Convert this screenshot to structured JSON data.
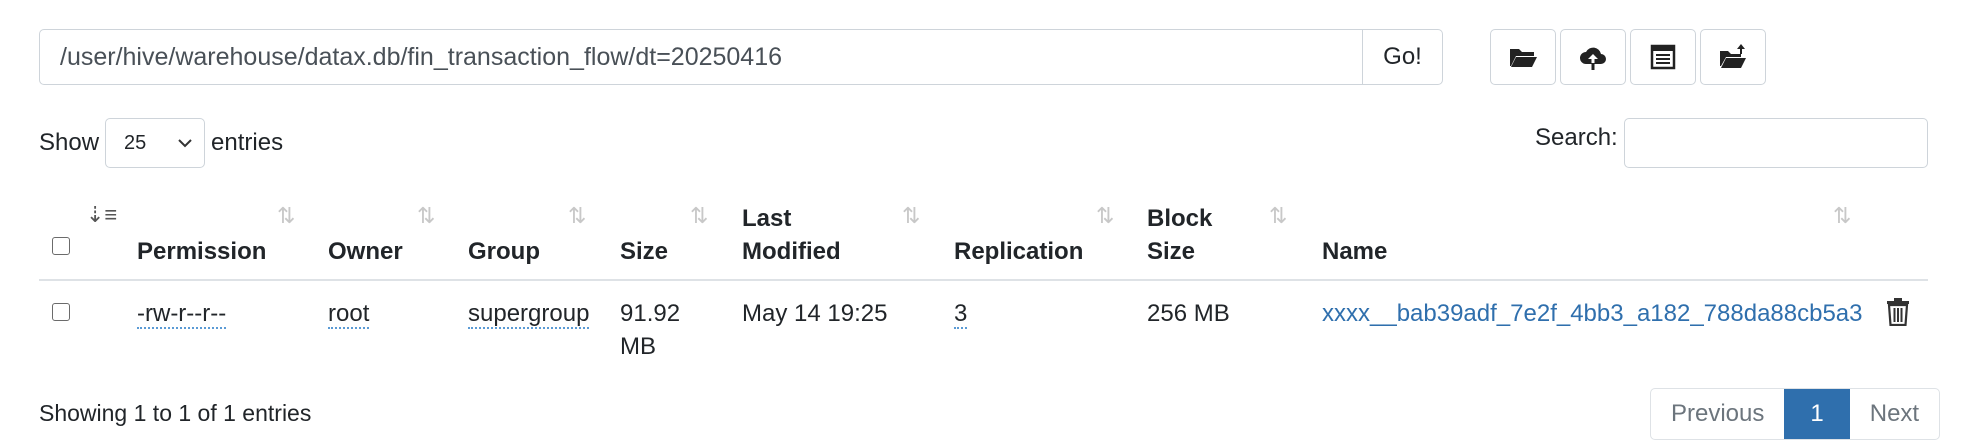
{
  "path_bar": {
    "path": "/user/hive/warehouse/datax.db/fin_transaction_flow/dt=20250416",
    "go_label": "Go!"
  },
  "toolbar": {
    "icons": [
      "folder-open-icon",
      "cloud-upload-icon",
      "table-list-icon",
      "folder-upload-icon"
    ]
  },
  "length_menu": {
    "show_label": "Show",
    "selected": "25",
    "entries_label": "entries"
  },
  "search": {
    "label": "Search:",
    "value": ""
  },
  "table": {
    "headers": {
      "permission": "Permission",
      "owner": "Owner",
      "group": "Group",
      "size": "Size",
      "last_modified_1": "Last",
      "last_modified_2": "Modified",
      "replication": "Replication",
      "block_size_1": "Block",
      "block_size_2": "Size",
      "name": "Name"
    },
    "rows": [
      {
        "permission": "-rw-r--r--",
        "owner": "root",
        "group": "supergroup",
        "size_1": "91.92",
        "size_2": "MB",
        "last_modified": "May 14 19:25",
        "replication": "3",
        "block_size": "256 MB",
        "name": "xxxx__bab39adf_7e2f_4bb3_a182_788da88cb5a3"
      }
    ]
  },
  "footer": {
    "info": "Showing 1 to 1 of 1 entries",
    "previous": "Previous",
    "current_page": "1",
    "next": "Next"
  }
}
